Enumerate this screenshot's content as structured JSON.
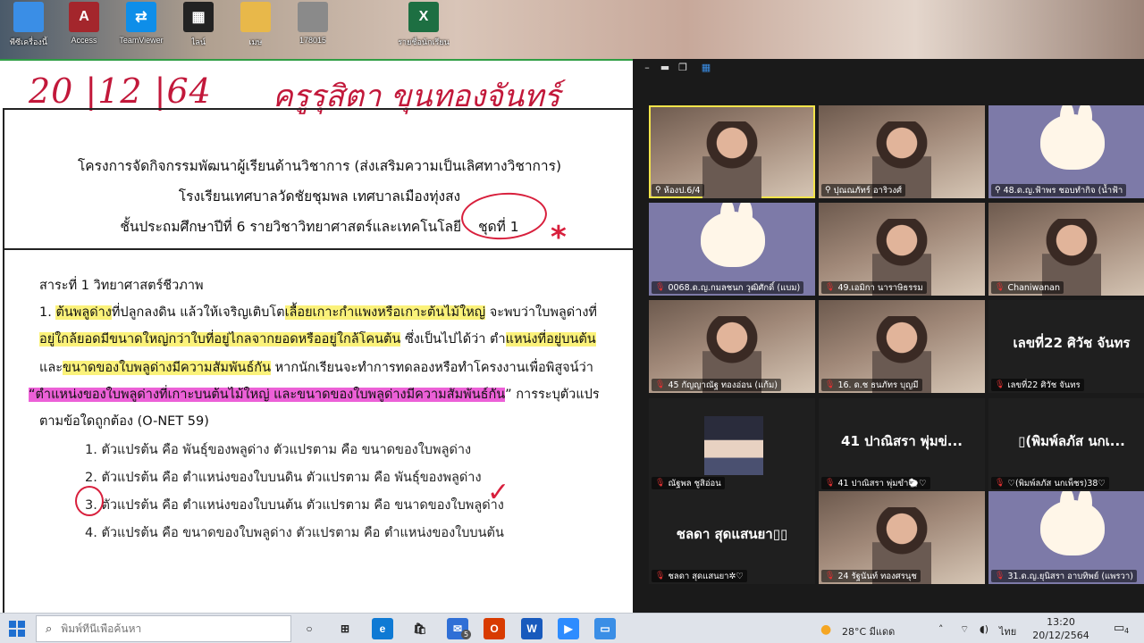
{
  "desktop": {
    "icons": [
      {
        "label": "พีซีเครื่องนี้",
        "icon": "computer-icon",
        "color": "#3a8ee6",
        "glyph": ""
      },
      {
        "label": "Access",
        "icon": "access-icon",
        "color": "#a4262c",
        "glyph": "A"
      },
      {
        "label": "TeamViewer",
        "icon": "teamviewer-icon",
        "color": "#0e8ee9",
        "glyph": "⇄"
      },
      {
        "label": "ไลน์",
        "icon": "qr-icon",
        "color": "#222222",
        "glyph": "▦"
      },
      {
        "label": "เมษ",
        "icon": "folder-icon",
        "color": "#e8b84a",
        "glyph": ""
      },
      {
        "label": "178015",
        "icon": "document-image-icon",
        "color": "#8a8a8a",
        "glyph": ""
      },
      {
        "label": "รายชื่อนักเรียน",
        "icon": "excel-icon",
        "color": "#1d6f42",
        "glyph": "X"
      }
    ]
  },
  "document": {
    "handwritten_date": "20 |12 |64",
    "handwritten_name": "ครูรุสิตา ขุนทองจันทร์",
    "header": {
      "line1": "โครงการจัดกิจกรรมพัฒนาผู้เรียนด้านวิชาการ (ส่งเสริมความเป็นเลิศทางวิชาการ)",
      "line2": "โรงเรียนเทศบาลวัดชัยชุมพล เทศบาลเมืองทุ่งสง",
      "line3": "ชั้นประถมศึกษาปีที่ 6 รายวิชาวิทยาศาสตร์และเทคโนโลยี",
      "set_label": "ชุดที่ 1"
    },
    "section_title": "สาระที่ 1 วิทยาศาสตร์ชีวภาพ",
    "question": {
      "l1_a": "1. ",
      "l1_b": "ต้นพลูด่าง",
      "l1_c": "ที่ปลูกลงดิน แล้วให้เจริญเติบโต",
      "l1_d": "เลื้อยเกาะกำแพงหรือเกาะต้นไม้ใหญ่",
      "l1_e": " จะพบว่าใบพลูด่างที่",
      "l2_a": "อยู่ใกล้ยอดมีขนาดใหญ่กว่าใบที่อยู่ไกลจากยอดหรืออยู่ใกล้โคนต้น",
      "l2_b": " ซึ่งเป็นไปได้ว่า ตำ",
      "l2_c": "แหน่งที่อยู่บนต้น",
      "l3_a": "และ",
      "l3_b": "ขนาดของใบพลูด่างมีความสัมพันธ์กัน",
      "l3_c": "  หากนักเรียนจะทำการทดลองหรือทำโครงงานเพื่อพิสูจน์ว่า",
      "l4_a": "“ตำแหน่งของใบพลูด่างที่เกาะบนต้นไม้ใหญ่ และขนาดของใบพลูด่างมีความสัมพันธ์กัน",
      "l4_b": "” การระบุตัวแปร",
      "l5": "ตามข้อใดถูกต้อง (O-NET 59)"
    },
    "choices": [
      "1. ตัวแปรต้น คือ พันธุ์ของพลูด่าง ตัวแปรตาม คือ ขนาดของใบพลูด่าง",
      "2. ตัวแปรต้น คือ ตำแหน่งของใบบนดิน ตัวแปรตาม คือ พันธุ์ของพลูด่าง",
      "3. ตัวแปรต้น คือ ตำแหน่งของใบบนต้น ตัวแปรตาม คือ ขนาดของใบพลูด่าง",
      "4. ตัวแปรต้น คือ ขนาดของใบพลูด่าง ตัวแปรตาม คือ ตำแหน่งของใบบนต้น"
    ],
    "checkmark": "✓",
    "star": "*"
  },
  "zoom": {
    "controls": [
      "–",
      "▬",
      "❐",
      "▦"
    ],
    "participants": [
      {
        "name": "ห้องป.6/4",
        "kind": "video",
        "mic": "pin"
      },
      {
        "name": "ปุณณภัทร์ อาริวงศ์",
        "kind": "video",
        "mic": "pin"
      },
      {
        "name": "48.ด.ญ.ฟ้าพร ชอบทำกิจ (น้ำฟ้า",
        "kind": "bunny",
        "mic": "pin"
      },
      {
        "name": "0068.ด.ญ.กมลชนก วุฒิศักดิ์ (แบม)",
        "kind": "bunny",
        "mic": "off"
      },
      {
        "name": "49.เอมิกา นาราษิธรรม",
        "kind": "video",
        "mic": "off"
      },
      {
        "name": "Chaniwanan",
        "kind": "video",
        "mic": "off"
      },
      {
        "name": "45 กัญญาณัฐ ทองอ่อน (แก้ม)",
        "kind": "video",
        "mic": "off"
      },
      {
        "name": "16. ด.ช ธนภัทร บุญมี",
        "kind": "video",
        "mic": "off"
      },
      {
        "name": "เลขที่22 ศิวัช จันทร",
        "kind": "name",
        "center": "เลขที่22 ศิวัช จันทร",
        "mic": "off"
      },
      {
        "name": "ณัฐพล ชูสิอ่อน",
        "kind": "avatar",
        "mic": "off"
      },
      {
        "name": "41 ปาณิสรา พุ่มขำ🐑♡",
        "kind": "name",
        "center": "41 ปาณิสรา พุ่มข่...",
        "mic": "off"
      },
      {
        "name": "♡(พิมพ์ลภัส นกเพ็ชร)38♡",
        "kind": "name",
        "center": "▯(พิมพ์ลภัส นกเ...",
        "mic": "off"
      },
      {
        "name": "ชลดา สุดแสนยา✲♡",
        "kind": "name",
        "center": "ชลดา สุดแสนยา▯▯",
        "mic": "off"
      },
      {
        "name": "24 รัฐนันท์ ทองศรนุช",
        "kind": "video",
        "mic": "off"
      },
      {
        "name": "31.ด.ญ.ยุนิสรา อาบทิพย์ (แพรวา)",
        "kind": "bunny",
        "mic": "off"
      }
    ]
  },
  "taskbar": {
    "search_placeholder": "พิมพ์ที่นี่เพื่อค้นหา",
    "apps": [
      {
        "icon": "task-view-icon",
        "glyph": "○",
        "color": "#dfe3ea"
      },
      {
        "icon": "file-explorer-icon",
        "glyph": "⊞",
        "color": "#dfe3ea"
      },
      {
        "icon": "edge-icon",
        "glyph": "e",
        "color": "#0f7ad4"
      },
      {
        "icon": "store-icon",
        "glyph": "🛍",
        "color": "#dfe3ea"
      },
      {
        "icon": "mail-icon",
        "glyph": "✉",
        "color": "#2f6fd6",
        "badge": "5"
      },
      {
        "icon": "office-icon",
        "glyph": "O",
        "color": "#d83b01"
      },
      {
        "icon": "word-icon",
        "glyph": "W",
        "color": "#185abd"
      },
      {
        "icon": "zoom-icon",
        "glyph": "▶",
        "color": "#2d8cff"
      },
      {
        "icon": "window-icon",
        "glyph": "▭",
        "color": "#3a8ee6"
      }
    ],
    "weather": "28°C มีแดด",
    "language": "ไทย",
    "time": "13:20",
    "date": "20/12/2564",
    "notifications": "4"
  }
}
